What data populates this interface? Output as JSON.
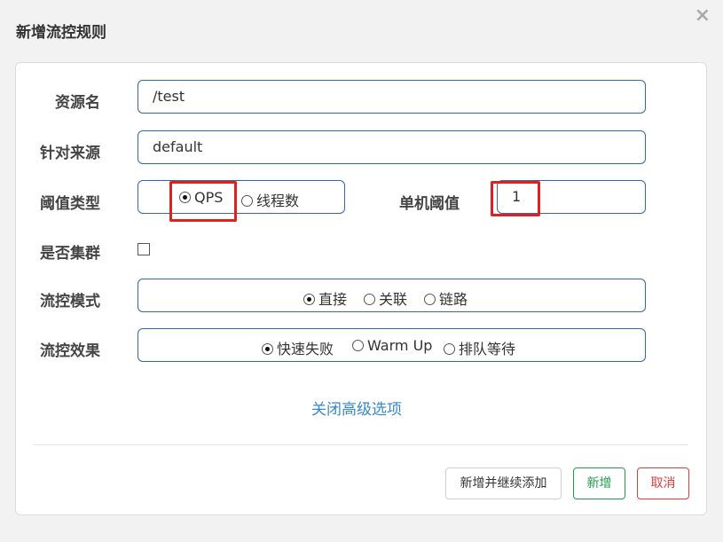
{
  "dialog": {
    "title": "新增流控规则",
    "close_icon": "×"
  },
  "form": {
    "resource": {
      "label": "资源名",
      "value": "/test"
    },
    "source": {
      "label": "针对来源",
      "value": "default"
    },
    "threshold_type": {
      "label": "阈值类型",
      "options": [
        {
          "label": "QPS",
          "selected": true
        },
        {
          "label": "线程数",
          "selected": false
        }
      ]
    },
    "single_threshold": {
      "label": "单机阈值",
      "value": "1"
    },
    "cluster": {
      "label": "是否集群",
      "checked": false
    },
    "flow_mode": {
      "label": "流控模式",
      "options": [
        {
          "label": "直接",
          "selected": true
        },
        {
          "label": "关联",
          "selected": false
        },
        {
          "label": "链路",
          "selected": false
        }
      ]
    },
    "flow_effect": {
      "label": "流控效果",
      "options": [
        {
          "label": "快速失败",
          "selected": true
        },
        {
          "label": "Warm Up",
          "selected": false
        },
        {
          "label": "排队等待",
          "selected": false
        }
      ]
    },
    "advanced_link": "关闭高级选项"
  },
  "footer": {
    "add_continue_label": "新增并继续添加",
    "add_label": "新增",
    "cancel_label": "取消"
  },
  "colors": {
    "field_border": "#2f6aa6",
    "link": "#3a87c8",
    "highlight": "#e02020",
    "add_button": "#1ea048",
    "cancel_button": "#e03b3b"
  }
}
